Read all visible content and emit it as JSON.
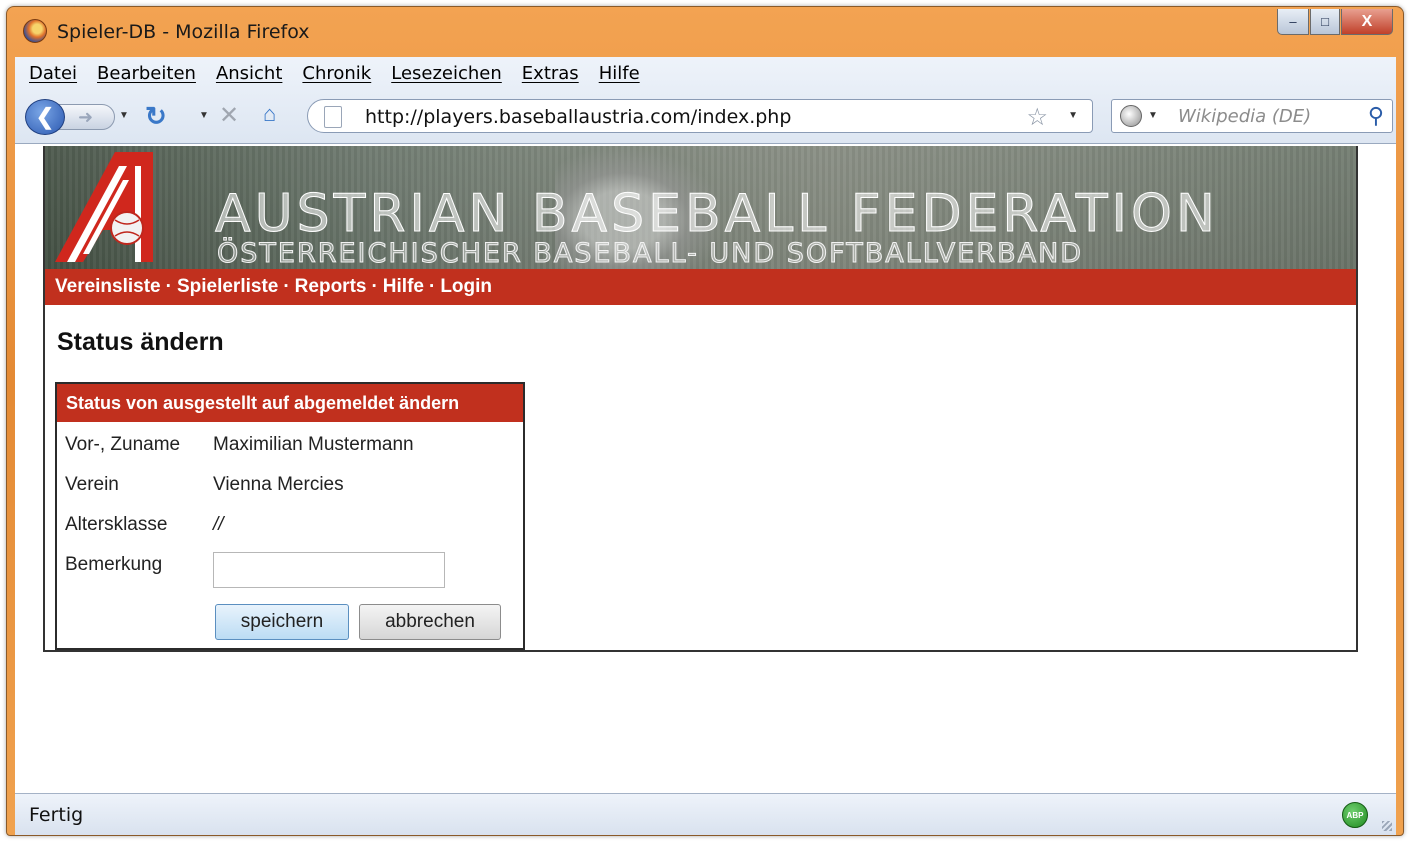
{
  "window": {
    "title": "Spieler-DB - Mozilla Firefox",
    "minimize_glyph": "–",
    "maximize_glyph": "□",
    "close_glyph": "X"
  },
  "menubar": {
    "items": [
      "Datei",
      "Bearbeiten",
      "Ansicht",
      "Chronik",
      "Lesezeichen",
      "Extras",
      "Hilfe"
    ]
  },
  "navbar": {
    "url": "http://players.baseballaustria.com/index.php",
    "search_placeholder": "Wikipedia (DE)",
    "icons": [
      "back-icon",
      "forward-icon",
      "reload-icon",
      "stop-icon",
      "home-icon",
      "bookmark-star-icon",
      "search-icon"
    ]
  },
  "banner": {
    "title": "AUSTRIAN BASEBALL FEDERATION",
    "subtitle": "ÖSTERREICHISCHER BASEBALL- UND SOFTBALLVERBAND"
  },
  "site_nav": {
    "links": [
      "Vereinsliste",
      "Spielerliste",
      "Reports",
      "Hilfe",
      "Login"
    ],
    "separator": "·"
  },
  "page": {
    "title": "Status ändern"
  },
  "form": {
    "header": "Status von ausgestellt auf abgemeldet ändern",
    "rows": [
      {
        "label": "Vor-, Zuname",
        "value": "Maximilian Mustermann"
      },
      {
        "label": "Verein",
        "value": "Vienna Mercies"
      },
      {
        "label": "Altersklasse",
        "value": "//"
      },
      {
        "label": "Bemerkung",
        "value": ""
      }
    ],
    "save_label": "speichern",
    "cancel_label": "abbrechen"
  },
  "statusbar": {
    "text": "Fertig",
    "addon_label": "ABP"
  },
  "colors": {
    "accent_red": "#c1301e",
    "window_orange": "#e48a34"
  }
}
